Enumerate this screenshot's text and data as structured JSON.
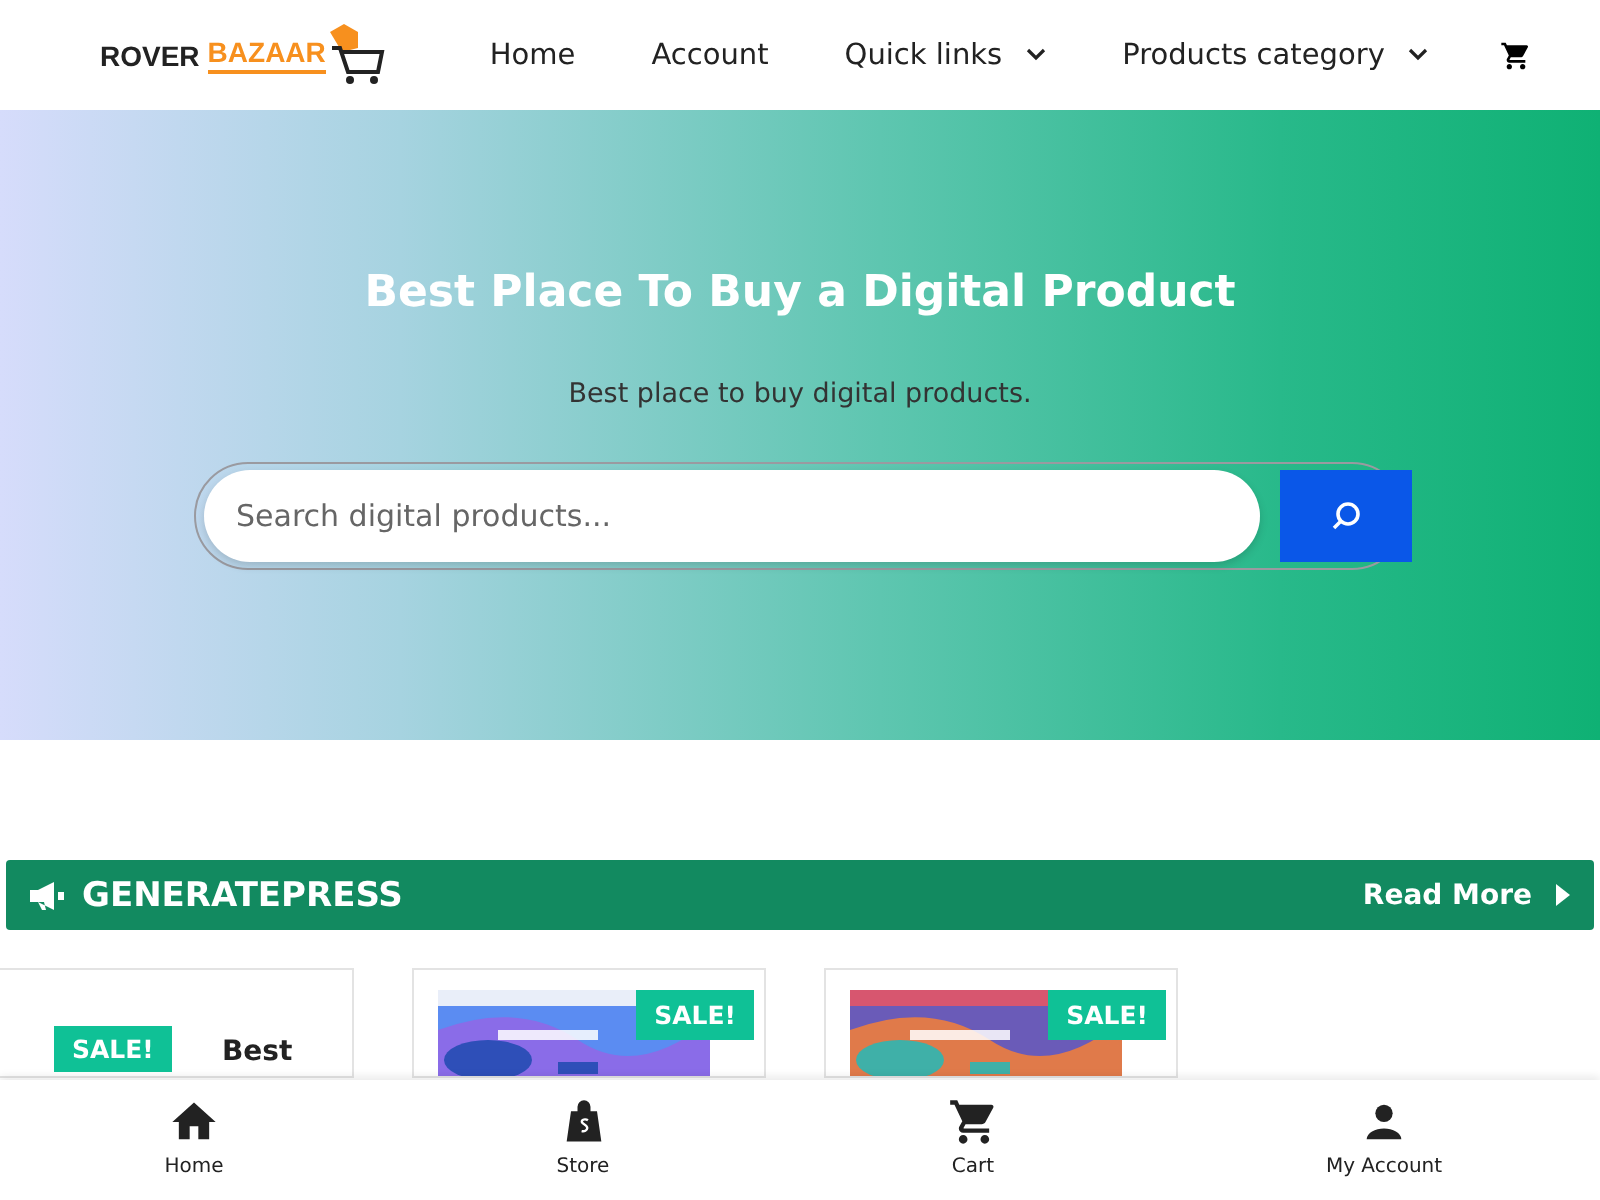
{
  "header": {
    "logo": {
      "word1": "ROVER",
      "word2": "BAZAAR"
    },
    "nav": [
      {
        "label": "Home",
        "dropdown": false
      },
      {
        "label": "Account",
        "dropdown": false
      },
      {
        "label": "Quick links",
        "dropdown": true
      },
      {
        "label": "Products category",
        "dropdown": true
      }
    ]
  },
  "hero": {
    "title": "Best Place To Buy a Digital Product",
    "subtitle": "Best place to buy digital products.",
    "search": {
      "placeholder": "Search digital products..."
    }
  },
  "section": {
    "title": "GENERATEPRESS",
    "link": "Read More"
  },
  "products": [
    {
      "kind": "text",
      "badge": "SALE!",
      "title": "Best"
    },
    {
      "kind": "picture",
      "badge": "SALE!"
    },
    {
      "kind": "picture",
      "badge": "SALE!"
    }
  ],
  "bottom_nav": [
    {
      "kind": "home",
      "label": "Home"
    },
    {
      "kind": "store",
      "label": "Store"
    },
    {
      "kind": "cart",
      "label": "Cart"
    },
    {
      "kind": "account",
      "label": "My Account"
    }
  ]
}
